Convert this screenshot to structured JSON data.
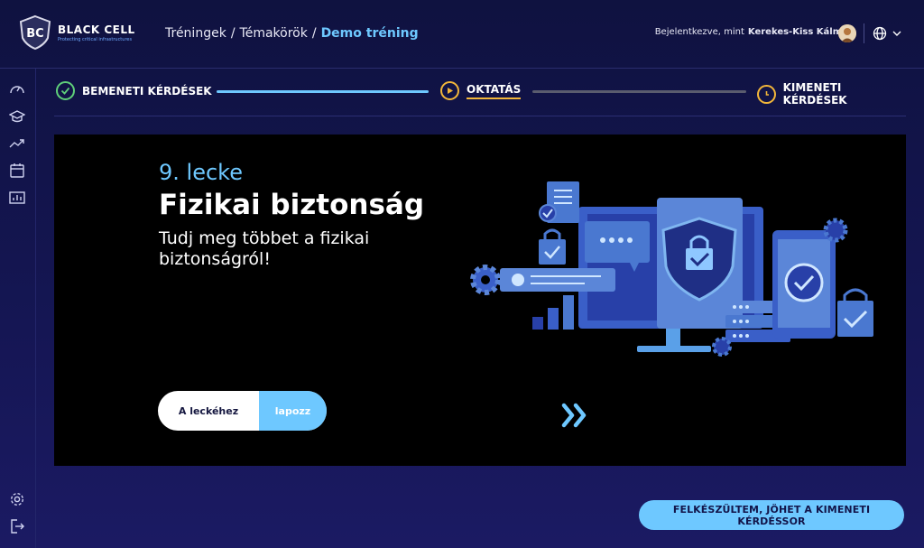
{
  "header": {
    "logo_name": "BLACK CELL",
    "logo_tagline": "Protecting critical infrastructures",
    "breadcrumb": [
      "Tréningek",
      "Témakörök",
      "Demo tréning"
    ],
    "breadcrumb_sep": "/",
    "user_prefix": "Bejelentkezve, mint",
    "user_name": "Kerekes-Kiss Kálmán"
  },
  "sidebar": {
    "icons": [
      "dashboard-icon",
      "graduation-cap-icon",
      "trend-icon",
      "calendar-icon",
      "bar-chart-icon",
      "settings-icon",
      "logout-icon"
    ]
  },
  "stepper": {
    "steps": [
      {
        "label": "BEMENETI KÉRDÉSEK",
        "state": "done"
      },
      {
        "label": "OKTATÁS",
        "state": "current"
      },
      {
        "label": "KIMENETI KÉRDÉSEK",
        "state": "pending"
      }
    ]
  },
  "lesson": {
    "number": "9. lecke",
    "title": "Fizikai biztonság",
    "subtitle": "Tudj meg többet a fizikai biztonságról!",
    "swipe_left": "A leckéhez",
    "swipe_right": "lapozz"
  },
  "cta": {
    "label": "FELKÉSZÜLTEM, JÖHET A KIMENETI KÉRDÉSSOR"
  },
  "colors": {
    "accent": "#6ec8ff",
    "success": "#5fd07a",
    "warning": "#f2b63a",
    "background": "#151654"
  }
}
